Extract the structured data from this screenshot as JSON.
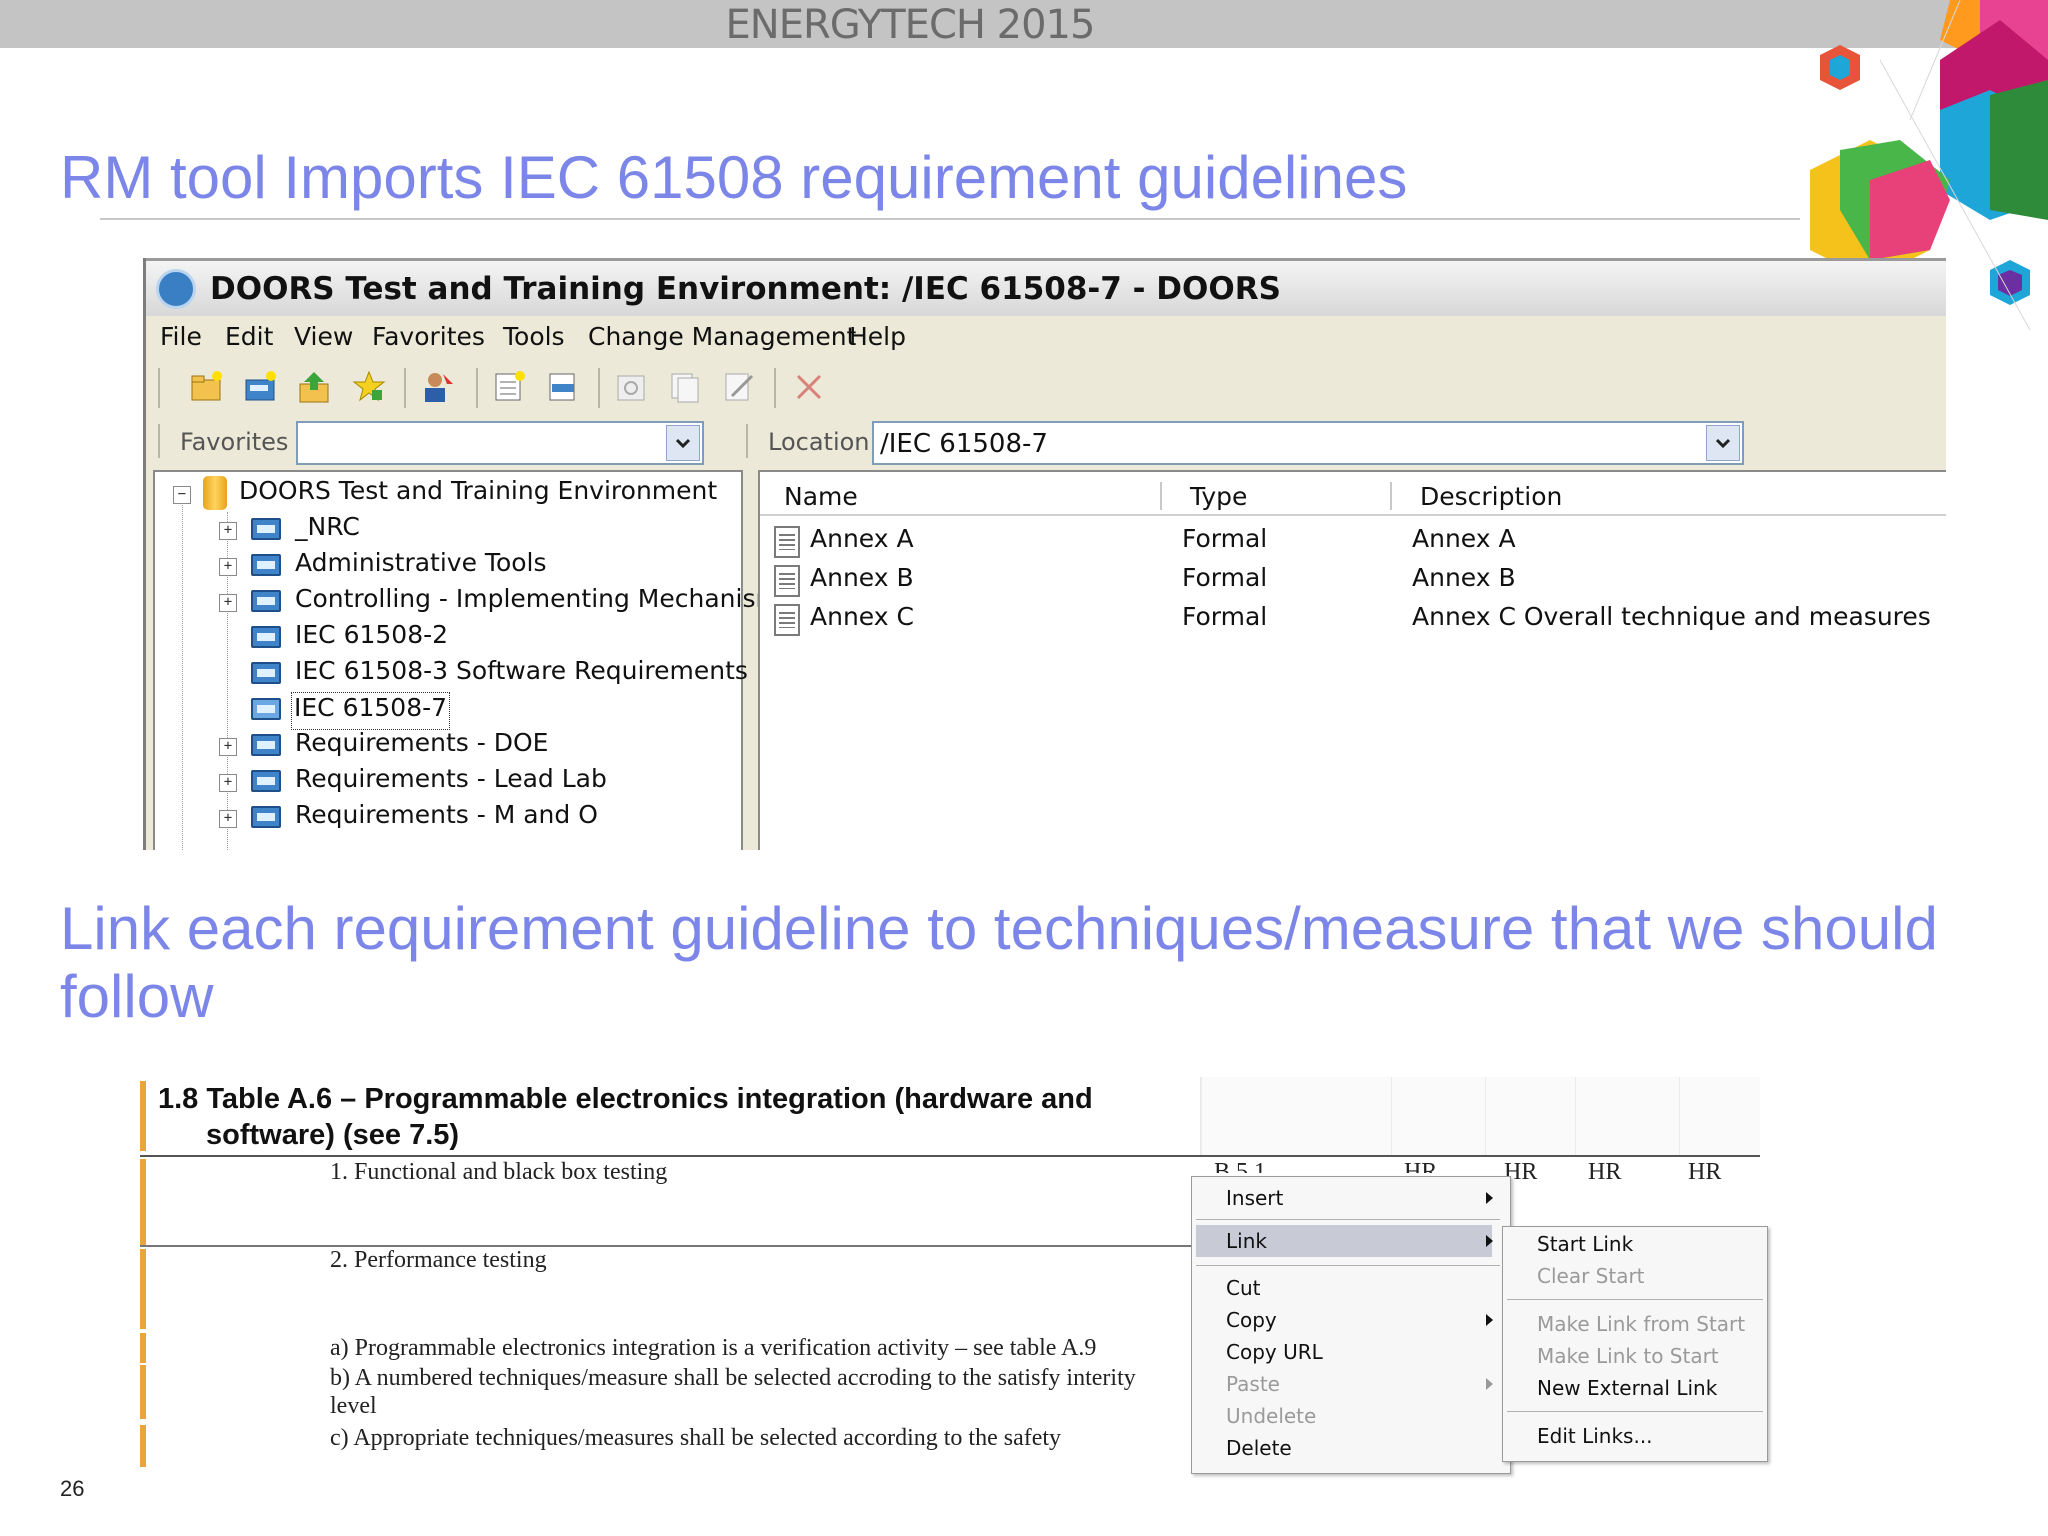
{
  "banner": {
    "title": "ENERGYTECH 2015"
  },
  "headings": {
    "first": "RM tool Imports IEC 61508 requirement guidelines",
    "second": "Link each requirement guideline to techniques/measure that we should follow"
  },
  "page_number": "26",
  "doors": {
    "title": "DOORS Test and Training Environment: /IEC 61508-7 - DOORS",
    "menu": [
      "File",
      "Edit",
      "View",
      "Favorites",
      "Tools",
      "Change Management",
      "Help"
    ],
    "toolbar_icons": [
      "new-folder-icon",
      "new-project-icon",
      "import-icon",
      "add-favorite-icon",
      "user-icon",
      "new-module-icon",
      "link-module-icon",
      "properties-icon",
      "copy-icon",
      "edit-icon",
      "delete-icon"
    ],
    "favorites_label": "Favorites",
    "favorites_value": "",
    "location_label": "Location",
    "location_value": "/IEC 61508-7",
    "tree": {
      "root": "DOORS Test and Training Environment",
      "items": [
        {
          "label": "_NRC",
          "expandable": true,
          "selected": false
        },
        {
          "label": "Administrative Tools",
          "expandable": true,
          "selected": false
        },
        {
          "label": "Controlling - Implementing Mechanisms",
          "expandable": true,
          "selected": false
        },
        {
          "label": "IEC 61508-2",
          "expandable": false,
          "selected": false
        },
        {
          "label": "IEC 61508-3 Software Requirements",
          "expandable": false,
          "selected": false
        },
        {
          "label": "IEC 61508-7",
          "expandable": false,
          "selected": true
        },
        {
          "label": "Requirements - DOE",
          "expandable": true,
          "selected": false
        },
        {
          "label": "Requirements - Lead Lab",
          "expandable": true,
          "selected": false
        },
        {
          "label": "Requirements - M and O",
          "expandable": true,
          "selected": false
        }
      ]
    },
    "list": {
      "columns": [
        "Name",
        "Type",
        "Description"
      ],
      "rows": [
        {
          "name": "Annex A",
          "type": "Formal",
          "description": "Annex A"
        },
        {
          "name": "Annex B",
          "type": "Formal",
          "description": "Annex B"
        },
        {
          "name": "Annex C",
          "type": "Formal",
          "description": "Annex C Overall technique and measures"
        }
      ]
    }
  },
  "document": {
    "header_line1": "1.8 Table A.6 – Programmable electronics integration (hardware and",
    "header_line2": "software) (see 7.5)",
    "rows": [
      "1. Functional and black box testing",
      "2. Performance testing",
      "a) Programmable electronics integration is a verification activity – see table A.9",
      "b) A numbered techniques/measure shall be selected accroding to the satisfy interity",
      "level",
      "c) Appropriate techniques/measures shall be selected according to the safety"
    ],
    "ref_cell": "B.5.1",
    "ratings": [
      "HR",
      "HR",
      "HR",
      "HR"
    ]
  },
  "context_menu": {
    "items": [
      {
        "label": "Insert",
        "submenu": true,
        "disabled": false
      },
      {
        "label": "Link",
        "submenu": true,
        "disabled": false,
        "highlighted": true
      },
      {
        "label": "Cut",
        "submenu": false,
        "disabled": false
      },
      {
        "label": "Copy",
        "submenu": true,
        "disabled": false
      },
      {
        "label": "Copy URL",
        "submenu": false,
        "disabled": false
      },
      {
        "label": "Paste",
        "submenu": true,
        "disabled": true
      },
      {
        "label": "Undelete",
        "submenu": false,
        "disabled": true
      },
      {
        "label": "Delete",
        "submenu": false,
        "disabled": false
      }
    ]
  },
  "link_submenu": {
    "items": [
      {
        "label": "Start Link",
        "disabled": false
      },
      {
        "label": "Clear Start",
        "disabled": true
      },
      {
        "label": "Make Link from Start",
        "disabled": true
      },
      {
        "label": "Make Link to Start",
        "disabled": true
      },
      {
        "label": "New External Link",
        "disabled": false
      },
      {
        "label": "Edit Links...",
        "disabled": false
      }
    ]
  },
  "colors": {
    "heading": "#7b86e8",
    "banner": "#c4c4c4",
    "window_chrome": "#ece9d8",
    "doc_accent": "#e8a53a",
    "menu_highlight": "#c8cbd6"
  }
}
